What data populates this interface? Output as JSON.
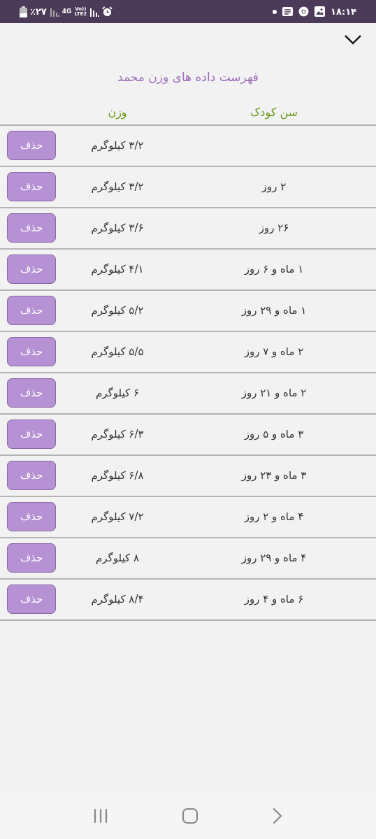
{
  "status_bar": {
    "battery": "٪۲۷",
    "network": "4G",
    "volte": "Vo))",
    "lte": "LTE2",
    "time": "۱۸:۱۴"
  },
  "title": "فهرست داده های وزن محمد",
  "columns": {
    "age": "سن کودک",
    "weight": "وزن"
  },
  "rows": [
    {
      "weight": "۳/۲ کیلوگرم",
      "delete": "حذف"
    },
    {
      "age": "۲ روز",
      "weight": "۳/۲ کیلوگرم",
      "delete": "حذف"
    },
    {
      "age": "۲۶ روز",
      "weight": "۳/۶ کیلوگرم",
      "delete": "حذف"
    },
    {
      "age": "۱ ماه و ۶ روز",
      "weight": "۴/۱ کیلوگرم",
      "delete": "حذف"
    },
    {
      "age": "۱ ماه و ۲۹ روز",
      "weight": "۵/۲ کیلوگرم",
      "delete": "حذف"
    },
    {
      "age": "۲ ماه و ۷ روز",
      "weight": "۵/۵ کیلوگرم",
      "delete": "حذف"
    },
    {
      "age": "۲ ماه و ۲۱ روز",
      "weight": "۶ کیلوگرم",
      "delete": "حذف"
    },
    {
      "age": "۳ ماه و ۵ روز",
      "weight": "۶/۳ کیلوگرم",
      "delete": "حذف"
    },
    {
      "age": "۳ ماه و ۲۳ روز",
      "weight": "۶/۸ کیلوگرم",
      "delete": "حذف"
    },
    {
      "age": "۴ ماه و ۲ روز",
      "weight": "۷/۲ کیلوگرم",
      "delete": "حذف"
    },
    {
      "age": "۴ ماه و ۲۹ روز",
      "weight": "۸ کیلوگرم",
      "delete": "حذف"
    },
    {
      "age": "۶ ماه و ۴ روز",
      "weight": "۸/۴ کیلوگرم",
      "delete": "حذف"
    }
  ]
}
